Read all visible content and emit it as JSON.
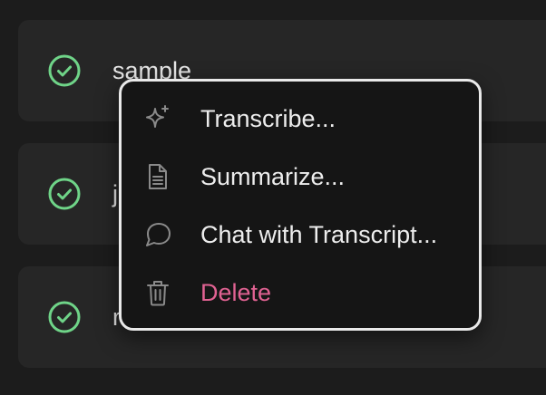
{
  "recordings": [
    {
      "name": "sample",
      "status_icon": "check-circle-icon"
    },
    {
      "name": "j",
      "status_icon": "check-circle-icon"
    },
    {
      "name": "r",
      "status_icon": "check-circle-icon"
    }
  ],
  "context_menu": {
    "items": [
      {
        "label": "Transcribe...",
        "icon": "sparkles-icon"
      },
      {
        "label": "Summarize...",
        "icon": "document-icon"
      },
      {
        "label": "Chat with Transcript...",
        "icon": "chat-bubble-icon"
      },
      {
        "label": "Delete",
        "icon": "trash-icon"
      }
    ]
  },
  "colors": {
    "background": "#1c1c1c",
    "row_background": "#262626",
    "success": "#6fd488",
    "menu_background": "#151515",
    "menu_border": "#e9e9e9",
    "danger": "#e06292",
    "icon_muted": "#8a8a8a"
  }
}
